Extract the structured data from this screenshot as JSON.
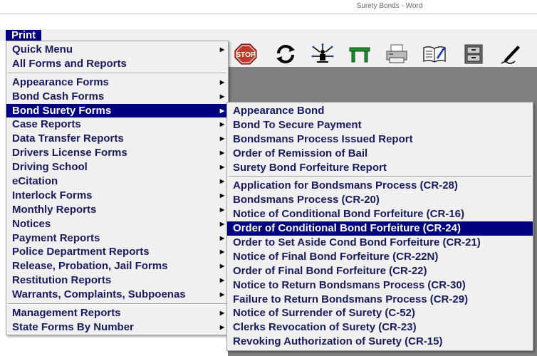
{
  "window": {
    "title": "Surety Bonds - Word"
  },
  "menubar": {
    "print": "Print"
  },
  "toolbar": {
    "buttons": [
      {
        "name": "stop-icon",
        "label": "STOP"
      },
      {
        "name": "refresh-icon"
      },
      {
        "name": "network-icon"
      },
      {
        "name": "table-icon"
      },
      {
        "name": "printer-icon"
      },
      {
        "name": "book-icon"
      },
      {
        "name": "cabinet-icon"
      },
      {
        "name": "pen-icon"
      }
    ]
  },
  "print_menu": {
    "groups": [
      [
        {
          "label": "Quick Menu",
          "submenu": true
        },
        {
          "label": "All Forms and Reports",
          "submenu": false
        }
      ],
      [
        {
          "label": "Appearance Forms",
          "submenu": true
        },
        {
          "label": "Bond Cash Forms",
          "submenu": true
        },
        {
          "label": "Bond Surety Forms",
          "submenu": true,
          "active": true
        },
        {
          "label": "Case Reports",
          "submenu": true
        },
        {
          "label": "Data Transfer Reports",
          "submenu": true
        },
        {
          "label": "Drivers License Forms",
          "submenu": true
        },
        {
          "label": "Driving School",
          "submenu": true
        },
        {
          "label": "eCitation",
          "submenu": true
        },
        {
          "label": "Interlock Forms",
          "submenu": true
        },
        {
          "label": "Monthly Reports",
          "submenu": true
        },
        {
          "label": "Notices",
          "submenu": true
        },
        {
          "label": "Payment Reports",
          "submenu": true
        },
        {
          "label": "Police Department Reports",
          "submenu": true
        },
        {
          "label": "Release, Probation, Jail Forms",
          "submenu": true
        },
        {
          "label": "Restitution Reports",
          "submenu": true
        },
        {
          "label": "Warrants, Complaints, Subpoenas",
          "submenu": true
        }
      ],
      [
        {
          "label": "Management Reports",
          "submenu": true
        },
        {
          "label": "State Forms By Number",
          "submenu": true
        }
      ]
    ]
  },
  "bond_surety_menu": {
    "groups": [
      [
        {
          "label": "Appearance Bond"
        },
        {
          "label": "Bond To Secure Payment"
        },
        {
          "label": "Bondsmans Process Issued Report"
        },
        {
          "label": "Order of Remission of Bail"
        },
        {
          "label": "Surety Bond Forfeiture Report"
        }
      ],
      [
        {
          "label": "Application for Bondsmans Process (CR-28)"
        },
        {
          "label": "Bondsmans Process (CR-20)"
        },
        {
          "label": "Notice of Conditional Bond Forfeiture (CR-16)"
        },
        {
          "label": "Order of Conditional Bond Forfeiture (CR-24)",
          "active": true
        },
        {
          "label": "Order to Set Aside Cond Bond Forfeiture (CR-21)"
        },
        {
          "label": "Notice of Final Bond Forfeiture (CR-22N)"
        },
        {
          "label": "Order of Final Bond Forfeiture (CR-22)"
        },
        {
          "label": "Notice to Return Bondsmans Process (CR-30)"
        },
        {
          "label": "Failure to Return Bondsmans Process (CR-29)"
        },
        {
          "label": "Notice of Surrender of Surety (C-52)"
        },
        {
          "label": "Clerks Revocation of Surety (CR-23)"
        },
        {
          "label": "Revoking Authorization of Surety (CR-15)"
        }
      ]
    ]
  },
  "colors": {
    "highlight": "#000080",
    "menu_bg": "#f0f0f0",
    "menu_text": "#1a1a60",
    "workspace": "#808080"
  }
}
